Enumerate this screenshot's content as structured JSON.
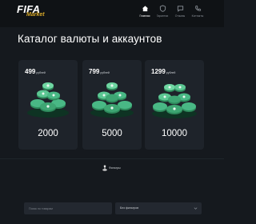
{
  "header": {
    "logo": {
      "main": "FIFA",
      "sub": "Market"
    },
    "nav": [
      {
        "label": "Главная",
        "icon": "home-icon",
        "active": true
      },
      {
        "label": "Гарантии",
        "icon": "shield-icon",
        "active": false
      },
      {
        "label": "Отзывы",
        "icon": "chat-icon",
        "active": false
      },
      {
        "label": "Контакты",
        "icon": "phone-icon",
        "active": false
      }
    ]
  },
  "main": {
    "title": "Каталог валюты и аккаунтов",
    "cards": [
      {
        "price": "499",
        "currency": "рублей",
        "amount": "2000"
      },
      {
        "price": "799",
        "currency": "рублей",
        "amount": "5000"
      },
      {
        "price": "1299",
        "currency": "рублей",
        "amount": "10000"
      }
    ]
  },
  "filters": {
    "label": "Фильтры",
    "icon": "filter-icon",
    "search_placeholder": "Поиск по товарам",
    "select_value": "Без фильтров"
  },
  "colors": {
    "background": "#15191e",
    "header": "#0f1215",
    "card": "#1e232a",
    "coin_green": "#3ea673",
    "logo_accent": "#d6a729"
  }
}
